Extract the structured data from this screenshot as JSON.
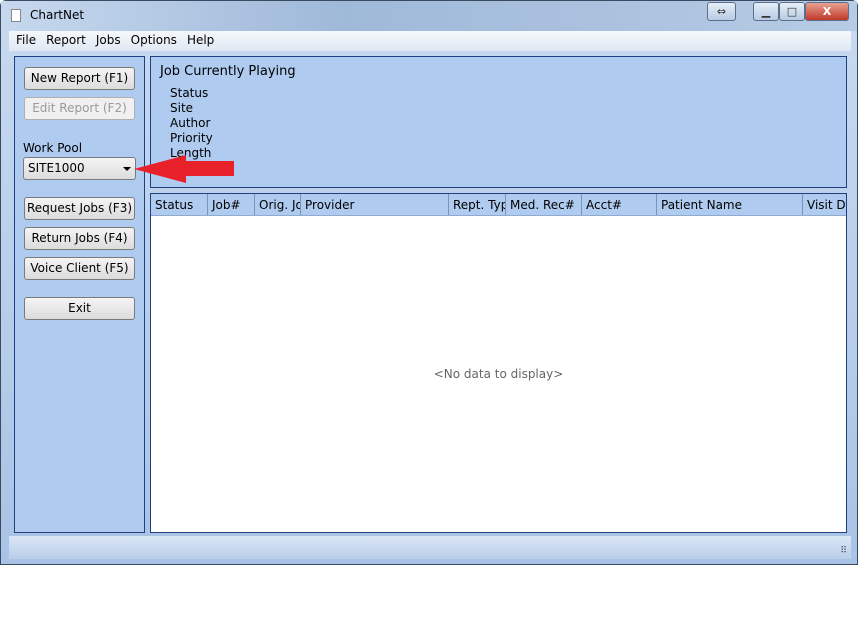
{
  "window": {
    "title": "ChartNet",
    "controls": [
      "⇔",
      "▁",
      "□",
      "X"
    ]
  },
  "menu": [
    "File",
    "Report",
    "Jobs",
    "Options",
    "Help"
  ],
  "left": {
    "new_report": "New Report (F1)",
    "edit_report": "Edit Report (F2)",
    "work_pool_label": "Work Pool",
    "work_pool_value": "SITE1000",
    "request_jobs": "Request Jobs (F3)",
    "return_jobs": "Return Jobs (F4)",
    "voice_client": "Voice Client (F5)",
    "exit": "Exit"
  },
  "playing": {
    "title": "Job Currently Playing",
    "fields": [
      "Status",
      "Site",
      "Author",
      "Priority",
      "Length"
    ]
  },
  "grid": {
    "columns": [
      "Status",
      "Job#",
      "Orig. Jo",
      "Provider",
      "Rept. Typ",
      "Med. Rec#",
      "Acct#",
      "Patient Name",
      "Visit D"
    ],
    "empty_text": "<No data to display>"
  },
  "annotation": {
    "arrow_color": "#e8202a"
  }
}
